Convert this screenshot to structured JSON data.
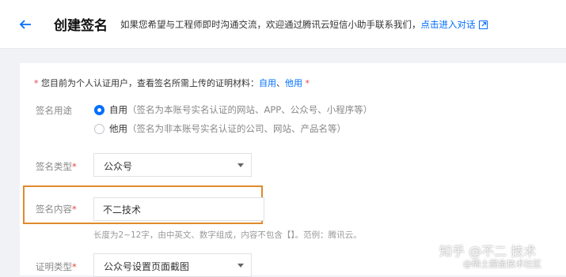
{
  "header": {
    "title": "创建签名",
    "description": "如果您希望与工程师即时沟通交流，欢迎通过腾讯云短信小助手联系我们，",
    "link_label": "点击进入对话"
  },
  "form": {
    "notice": {
      "star": "*",
      "text": " 您目前为个人认证用户，查看签名所需上传的证明材料：",
      "link_self": "自用",
      "separator": "、",
      "link_other": "他用",
      "star_end": " *"
    },
    "purpose": {
      "label": "签名用途",
      "options": [
        {
          "label": "自用",
          "hint": "（签名为本账号实名认证的网站、APP、公众号、小程序等）",
          "selected": true
        },
        {
          "label": "他用",
          "hint": "（签名为非本账号实名认证的公司、网站、产品名等）",
          "selected": false
        }
      ]
    },
    "type": {
      "label": "签名类型",
      "star": "*",
      "value": "公众号"
    },
    "content": {
      "label": "签名内容",
      "star": "*",
      "value": "不二技术",
      "help": "长度为2~12字，由中英文、数字组成，内容不包含【】。范例：腾讯云。"
    },
    "proof": {
      "label": "证明类型",
      "star": "*",
      "value": "公众号设置页面截图"
    }
  },
  "watermark": {
    "line1": "知乎 @不二 技术",
    "line2": "@稀土掘金技术社区"
  },
  "colors": {
    "accent": "#006eff",
    "required": "#e54545",
    "highlight": "#e08a2b"
  }
}
